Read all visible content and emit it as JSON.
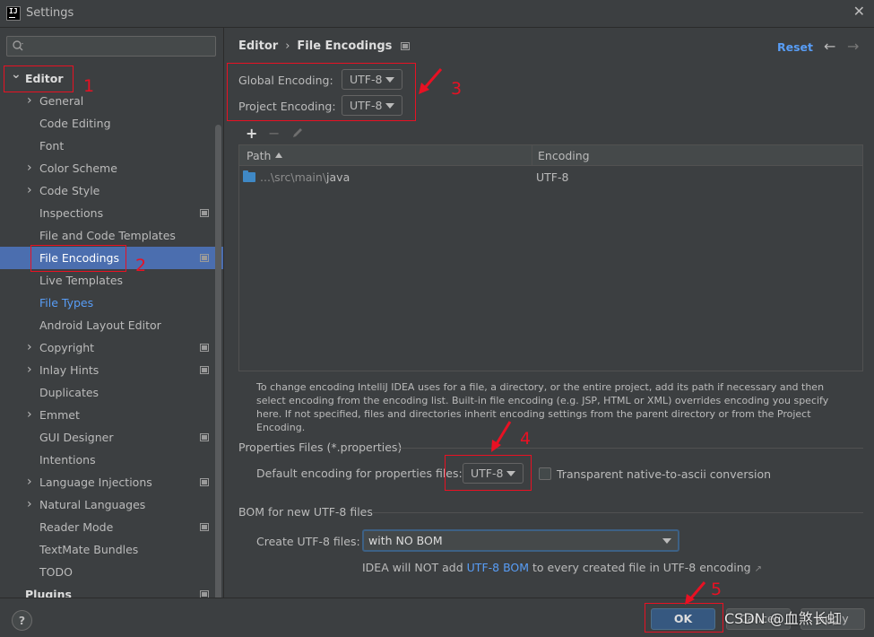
{
  "window": {
    "title": "Settings",
    "app_icon": "IJ"
  },
  "sidebar": {
    "search_placeholder": "",
    "items": [
      {
        "label": "Editor",
        "level": 0,
        "expand": "down",
        "bold": true
      },
      {
        "label": "General",
        "level": 1,
        "expand": "right"
      },
      {
        "label": "Code Editing",
        "level": 1
      },
      {
        "label": "Font",
        "level": 1
      },
      {
        "label": "Color Scheme",
        "level": 1,
        "expand": "right"
      },
      {
        "label": "Code Style",
        "level": 1,
        "expand": "right"
      },
      {
        "label": "Inspections",
        "level": 1,
        "badge": true
      },
      {
        "label": "File and Code Templates",
        "level": 1
      },
      {
        "label": "File Encodings",
        "level": 1,
        "badge": true,
        "selected": true
      },
      {
        "label": "Live Templates",
        "level": 1
      },
      {
        "label": "File Types",
        "level": 1,
        "link": true
      },
      {
        "label": "Android Layout Editor",
        "level": 1
      },
      {
        "label": "Copyright",
        "level": 1,
        "expand": "right",
        "badge": true
      },
      {
        "label": "Inlay Hints",
        "level": 1,
        "expand": "right",
        "badge": true
      },
      {
        "label": "Duplicates",
        "level": 1
      },
      {
        "label": "Emmet",
        "level": 1,
        "expand": "right"
      },
      {
        "label": "GUI Designer",
        "level": 1,
        "badge": true
      },
      {
        "label": "Intentions",
        "level": 1
      },
      {
        "label": "Language Injections",
        "level": 1,
        "expand": "right",
        "badge": true
      },
      {
        "label": "Natural Languages",
        "level": 1,
        "expand": "right"
      },
      {
        "label": "Reader Mode",
        "level": 1,
        "badge": true
      },
      {
        "label": "TextMate Bundles",
        "level": 1
      },
      {
        "label": "TODO",
        "level": 1
      },
      {
        "label": "Plugins",
        "level": 0,
        "bold": true,
        "badge": true
      }
    ]
  },
  "header": {
    "breadcrumb_parent": "Editor",
    "breadcrumb_separator": "›",
    "breadcrumb_current": "File Encodings",
    "reset_label": "Reset",
    "back_glyph": "←",
    "forward_glyph": "→"
  },
  "encodings": {
    "global_label": "Global Encoding:",
    "global_value": "UTF-8",
    "project_label": "Project Encoding:",
    "project_value": "UTF-8"
  },
  "toolbar": {
    "add_glyph": "+",
    "remove_glyph": "−"
  },
  "table": {
    "columns": [
      "Path",
      "Encoding"
    ],
    "rows": [
      {
        "path_prefix": "...\\src\\main\\",
        "path_name": "java",
        "encoding": "UTF-8"
      }
    ]
  },
  "help_text": "To change encoding IntelliJ IDEA uses for a file, a directory, or the entire project, add its path if necessary and then select encoding from the encoding list. Built-in file encoding (e.g. JSP, HTML or XML) overrides encoding you specify here. If not specified, files and directories inherit encoding settings from the parent directory or from the Project Encoding.",
  "properties": {
    "section_title": "Properties Files (*.properties)",
    "default_label": "Default encoding for properties files:",
    "default_value": "UTF-8",
    "native_ascii_label": "Transparent native-to-ascii conversion",
    "native_ascii_checked": false
  },
  "bom": {
    "section_title": "BOM for new UTF-8 files",
    "create_label": "Create UTF-8 files:",
    "create_value": "with NO BOM",
    "note_prefix": "IDEA will NOT add ",
    "note_link": "UTF-8 BOM",
    "note_suffix": " to every created file in UTF-8 encoding",
    "note_arrow": "↗"
  },
  "footer": {
    "help_label": "?",
    "ok_label": "OK",
    "cancel_label": "Cancel",
    "apply_label": "Apply",
    "watermark": "CSDN @血煞长虹"
  },
  "annotations": [
    "1",
    "2",
    "3",
    "4",
    "5"
  ],
  "colors": {
    "background": "#3c3f41",
    "selection": "#4b6eaf",
    "link": "#589df6",
    "primary_button": "#365880",
    "annotation": "#e81123",
    "folder": "#3f88c5"
  }
}
